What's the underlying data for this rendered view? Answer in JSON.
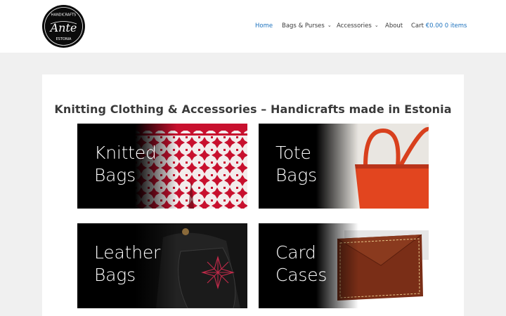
{
  "brand": {
    "logo_top": "HANDICRAFTS",
    "logo_main": "Ante",
    "logo_bottom": "ESTONIA"
  },
  "nav": {
    "home": "Home",
    "bags": "Bags & Purses",
    "accessories": "Accessories",
    "about": "About",
    "cart": "Cart",
    "cart_total": "€0.00",
    "cart_items": "0 items",
    "chevron": "⌄"
  },
  "page": {
    "title": "Knitting Clothing & Accessories – Handicrafts made in Estonia"
  },
  "tiles": [
    {
      "line1": "Knitted",
      "line2": "Bags"
    },
    {
      "line1": "Tote",
      "line2": "Bags"
    },
    {
      "line1": "Leather",
      "line2": "Bags"
    },
    {
      "line1": "Card",
      "line2": "Cases"
    }
  ],
  "colors": {
    "accent": "#1e73be",
    "page_bg": "#f0f0f0",
    "knit_red": "#c8102e",
    "tote_orange": "#e2451f",
    "leather_brown": "#7a2e17"
  }
}
